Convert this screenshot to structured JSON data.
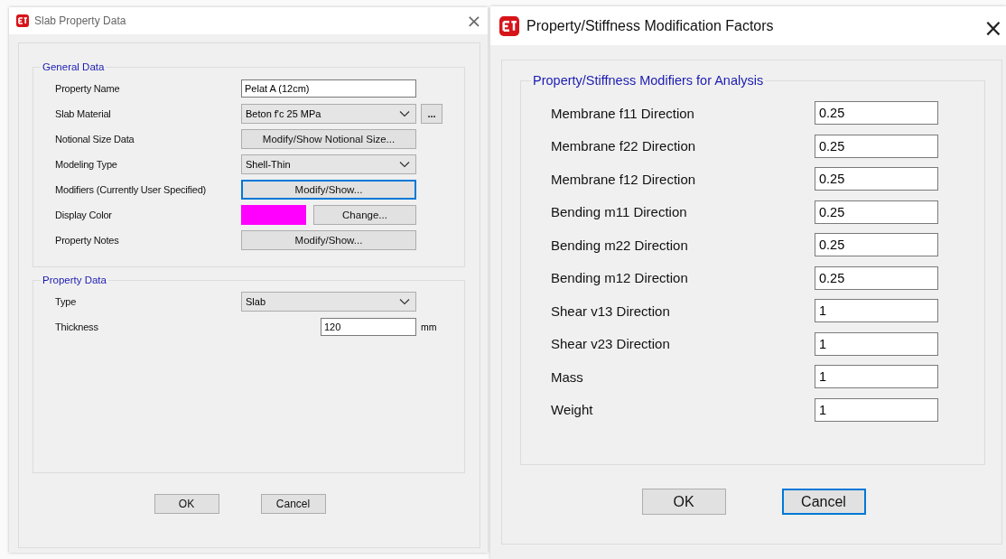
{
  "slab_dialog": {
    "title": "Slab Property Data",
    "close": "×",
    "general_data": {
      "title": "General Data",
      "rows": [
        {
          "kind": "text",
          "label": "Property Name",
          "value": "Pelat A (12cm)"
        },
        {
          "kind": "combo",
          "label": "Slab Material",
          "value": "Beton f'c 25 MPa",
          "extra_button": "..."
        },
        {
          "kind": "button",
          "label": "Notional Size Data",
          "button": "Modify/Show Notional Size...",
          "focused": false
        },
        {
          "kind": "combo",
          "label": "Modeling Type",
          "value": "Shell-Thin"
        },
        {
          "kind": "button",
          "label": "Modifiers (Currently User Specified)",
          "button": "Modify/Show...",
          "focused": true
        },
        {
          "kind": "color",
          "label": "Display Color",
          "color": "#ff00ff",
          "button": "Change..."
        },
        {
          "kind": "button",
          "label": "Property Notes",
          "button": "Modify/Show...",
          "focused": false
        }
      ]
    },
    "property_data": {
      "title": "Property Data",
      "rows": [
        {
          "kind": "combo",
          "label": "Type",
          "value": "Slab"
        },
        {
          "kind": "number",
          "label": "Thickness",
          "value": "120",
          "unit": "mm"
        }
      ]
    },
    "buttons": [
      {
        "label": "OK",
        "focused": false
      },
      {
        "label": "Cancel",
        "focused": false
      }
    ]
  },
  "modifiers_dialog": {
    "title": "Property/Stiffness Modification Factors",
    "close": "×",
    "group": {
      "title": "Property/Stiffness Modifiers for Analysis",
      "rows": [
        {
          "label": "Membrane f11 Direction",
          "value": "0.25"
        },
        {
          "label": "Membrane f22 Direction",
          "value": "0.25"
        },
        {
          "label": "Membrane f12 Direction",
          "value": "0.25"
        },
        {
          "label": "Bending m11 Direction",
          "value": "0.25"
        },
        {
          "label": "Bending m22 Direction",
          "value": "0.25"
        },
        {
          "label": "Bending m12 Direction",
          "value": "0.25"
        },
        {
          "label": "Shear v13 Direction",
          "value": "1"
        },
        {
          "label": "Shear v23 Direction",
          "value": "1"
        },
        {
          "label": "Mass",
          "value": "1"
        },
        {
          "label": "Weight",
          "value": "1"
        }
      ]
    },
    "buttons": [
      {
        "label": "OK",
        "focused": false
      },
      {
        "label": "Cancel",
        "focused": true
      }
    ]
  }
}
